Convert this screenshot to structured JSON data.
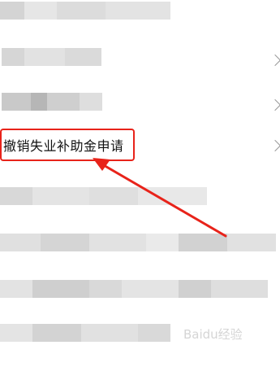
{
  "menu": {
    "items": [
      {
        "label": "",
        "redacted": true,
        "has_chevron": false
      },
      {
        "label": "",
        "redacted": true,
        "has_chevron": true
      },
      {
        "label": "",
        "redacted": true,
        "has_chevron": true
      },
      {
        "label": "撤销失业补助金申请",
        "redacted": false,
        "has_chevron": true,
        "highlighted": true
      },
      {
        "label": "",
        "redacted": true,
        "has_chevron": false
      },
      {
        "label": "",
        "redacted": true,
        "has_chevron": false
      },
      {
        "label": "",
        "redacted": true,
        "has_chevron": false
      },
      {
        "label": "",
        "redacted": true,
        "has_chevron": false
      }
    ]
  },
  "annotation": {
    "highlight_color": "#e8231a",
    "arrow_color": "#e8231a"
  },
  "watermark": {
    "text": "Baidu经验",
    "color": "#d5d5d5"
  },
  "icons": {
    "chevron": "chevron-right-icon"
  }
}
